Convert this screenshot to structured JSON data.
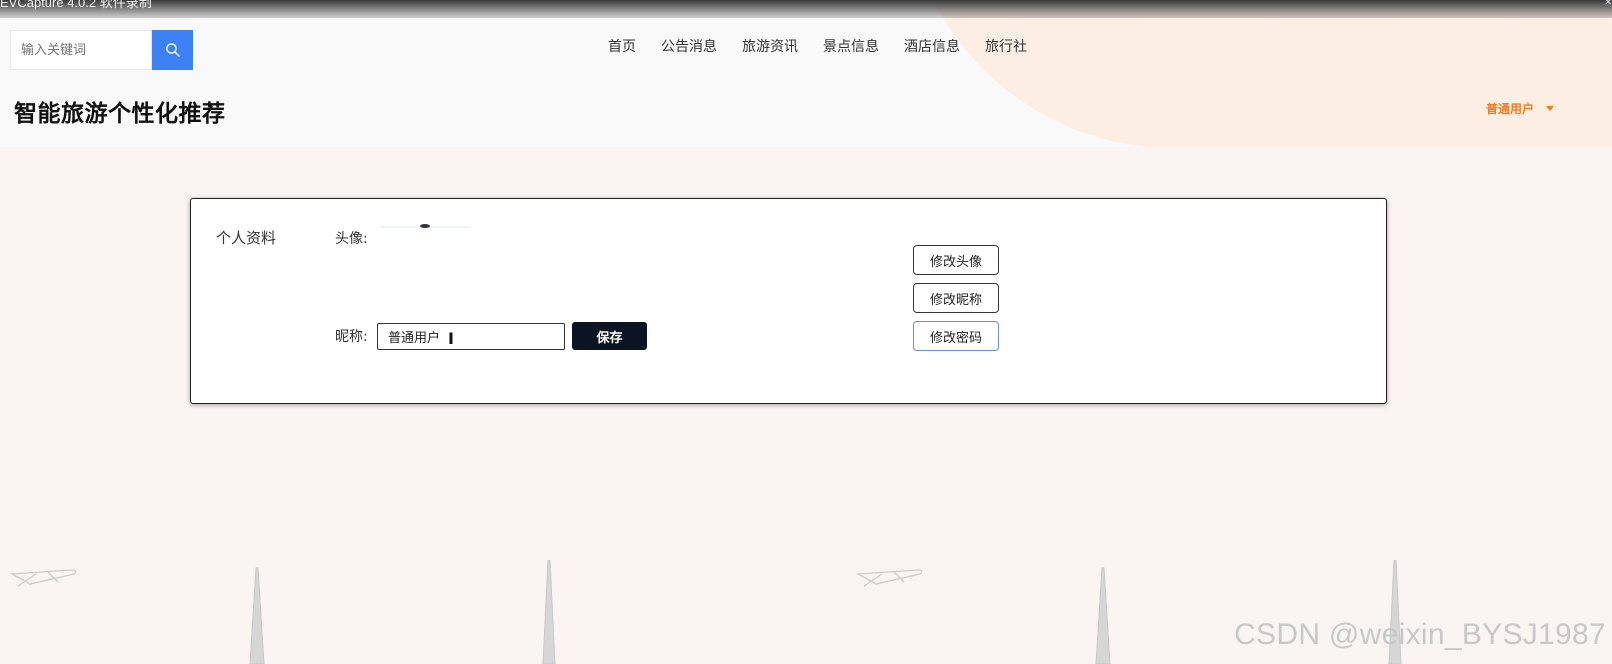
{
  "capture_bar": {
    "title": "EVCapture 4.0.2 软件录制",
    "close_glyph": "×"
  },
  "search": {
    "placeholder": "输入关键词",
    "icon": "search-icon"
  },
  "nav": {
    "items": [
      {
        "label": "首页"
      },
      {
        "label": "公告消息"
      },
      {
        "label": "旅游资讯"
      },
      {
        "label": "景点信息"
      },
      {
        "label": "酒店信息"
      },
      {
        "label": "旅行社"
      }
    ]
  },
  "header": {
    "site_title": "智能旅游个性化推荐",
    "user_menu_label": "普通用户"
  },
  "profile": {
    "section_label": "个人资料",
    "avatar_label": "头像:",
    "nickname_label": "昵称:",
    "nickname_value": "普通用户",
    "save_label": "保存",
    "change_avatar_label": "修改头像",
    "change_nickname_label": "修改昵称",
    "change_password_label": "修改密码"
  },
  "watermark": "CSDN @weixin_BYSJ1987",
  "colors": {
    "accent_blue": "#3c82f6",
    "user_orange": "#f07c22",
    "save_dark": "#0c1424",
    "page_bg": "#faf5f3",
    "header_peach": "#fdeee3"
  }
}
